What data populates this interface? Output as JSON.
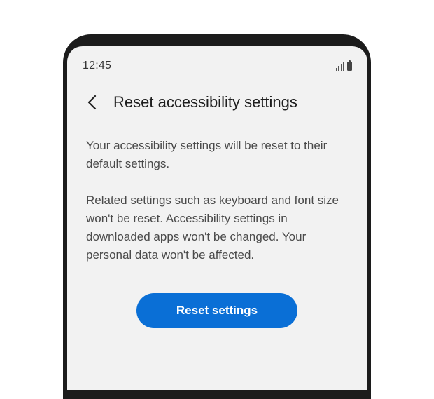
{
  "status_bar": {
    "time": "12:45",
    "icons": [
      "signal-icon",
      "battery-icon"
    ]
  },
  "header": {
    "back_icon": "chevron-left-icon",
    "title": "Reset accessibility settings"
  },
  "content": {
    "paragraph_1": "Your accessibility settings will be reset to their default settings.",
    "paragraph_2": "Related settings such as keyboard and font size won't be reset. Accessibility settings in downloaded apps won't be changed. Your personal data won't be affected."
  },
  "actions": {
    "reset_label": "Reset settings"
  },
  "colors": {
    "accent": "#0a6fd6",
    "screen_background": "#f2f2f2",
    "frame": "#1c1c1c"
  }
}
